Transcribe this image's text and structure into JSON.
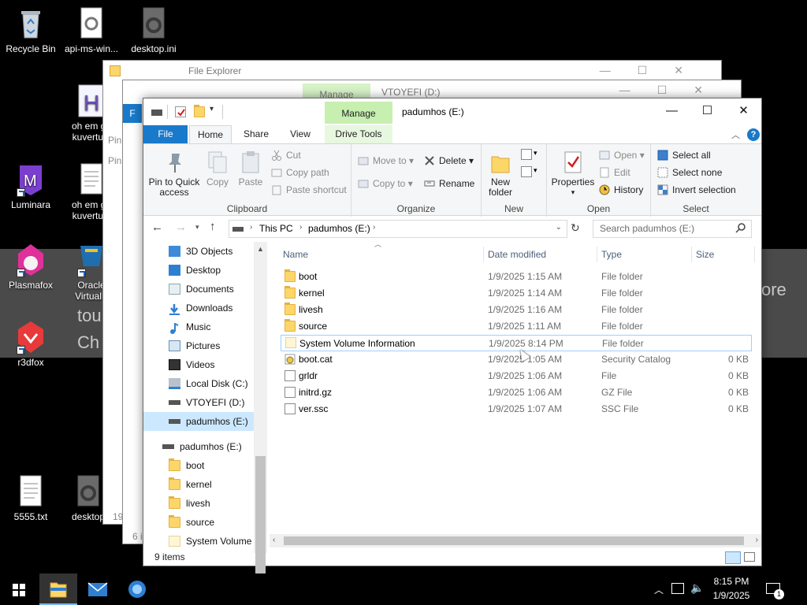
{
  "desktop": {
    "icons": [
      {
        "label": "Recycle Bin",
        "icon": "recycle-bin-icon"
      },
      {
        "label": "api-ms-win...",
        "icon": "settings-file-icon"
      },
      {
        "label": "desktop.ini",
        "icon": "settings-file-icon"
      },
      {
        "label": "oh em ge kuvertu s",
        "icon": "app-icon"
      },
      {
        "label": "Luminara",
        "icon": "luminara-icon"
      },
      {
        "label": "oh em ge kuvertu s",
        "icon": "text-file-icon"
      },
      {
        "label": "Plasmafox",
        "icon": "plasmafox-icon"
      },
      {
        "label": "Oracle VirtualB",
        "icon": "virtualbox-icon"
      },
      {
        "label": "r3dfox",
        "icon": "r3dfox-icon"
      },
      {
        "label": "5555.txt",
        "icon": "text-file-icon"
      },
      {
        "label": "desktop",
        "icon": "settings-file-icon"
      }
    ],
    "banner_lines": [
      "tou",
      "Ch",
      "ore"
    ]
  },
  "back_windows": [
    {
      "title": "File Explorer",
      "partial": [
        "Pin",
        "Pin",
        "19",
        "6 i"
      ]
    },
    {
      "title": "VTOYEFI (D:)",
      "manage": "Manage",
      "partial": [
        "F"
      ]
    }
  ],
  "window": {
    "title": "padumhos (E:)",
    "manage_tab": "Manage",
    "tabs": [
      "File",
      "Home",
      "Share",
      "View",
      "Drive Tools"
    ],
    "ribbon": {
      "clipboard": {
        "pin": "Pin to Quick access",
        "copy": "Copy",
        "paste": "Paste",
        "cut": "Cut",
        "copy_path": "Copy path",
        "paste_shortcut": "Paste shortcut",
        "label": "Clipboard"
      },
      "organize": {
        "move_to": "Move to",
        "copy_to": "Copy to",
        "delete": "Delete",
        "rename": "Rename",
        "label": "Organize"
      },
      "new": {
        "new_folder": "New folder",
        "label": "New"
      },
      "open": {
        "properties": "Properties",
        "open": "Open",
        "edit": "Edit",
        "history": "History",
        "label": "Open"
      },
      "select": {
        "select_all": "Select all",
        "select_none": "Select none",
        "invert": "Invert selection",
        "label": "Select"
      }
    },
    "address": {
      "segments": [
        "This PC",
        "padumhos (E:)"
      ]
    },
    "search": {
      "placeholder": "Search padumhos (E:)"
    },
    "nav": [
      {
        "label": "3D Objects",
        "icon": "3d-objects-icon"
      },
      {
        "label": "Desktop",
        "icon": "desktop-icon"
      },
      {
        "label": "Documents",
        "icon": "documents-icon"
      },
      {
        "label": "Downloads",
        "icon": "downloads-icon"
      },
      {
        "label": "Music",
        "icon": "music-icon"
      },
      {
        "label": "Pictures",
        "icon": "pictures-icon"
      },
      {
        "label": "Videos",
        "icon": "videos-icon"
      },
      {
        "label": "Local Disk (C:)",
        "icon": "local-disk-icon"
      },
      {
        "label": "VTOYEFI (D:)",
        "icon": "drive-icon"
      },
      {
        "label": "padumhos (E:)",
        "icon": "drive-icon"
      },
      {
        "label": "padumhos (E:)",
        "icon": "drive-icon"
      },
      {
        "label": "boot",
        "icon": "folder-icon"
      },
      {
        "label": "kernel",
        "icon": "folder-icon"
      },
      {
        "label": "livesh",
        "icon": "folder-icon"
      },
      {
        "label": "source",
        "icon": "folder-icon"
      },
      {
        "label": "System Volume I",
        "icon": "folder-icon"
      }
    ],
    "columns": {
      "name": "Name",
      "date": "Date modified",
      "type": "Type",
      "size": "Size"
    },
    "files": [
      {
        "name": "boot",
        "date": "1/9/2025 1:15 AM",
        "type": "File folder",
        "size": "",
        "icon": "folder-icon"
      },
      {
        "name": "kernel",
        "date": "1/9/2025 1:14 AM",
        "type": "File folder",
        "size": "",
        "icon": "folder-icon"
      },
      {
        "name": "livesh",
        "date": "1/9/2025 1:16 AM",
        "type": "File folder",
        "size": "",
        "icon": "folder-icon"
      },
      {
        "name": "source",
        "date": "1/9/2025 1:11 AM",
        "type": "File folder",
        "size": "",
        "icon": "folder-icon"
      },
      {
        "name": "System Volume Information",
        "date": "1/9/2025 8:14 PM",
        "type": "File folder",
        "size": "",
        "icon": "folder-icon"
      },
      {
        "name": "boot.cat",
        "date": "1/9/2025 1:05 AM",
        "type": "Security Catalog",
        "size": "0 KB",
        "icon": "security-catalog-icon"
      },
      {
        "name": "grldr",
        "date": "1/9/2025 1:06 AM",
        "type": "File",
        "size": "0 KB",
        "icon": "file-icon"
      },
      {
        "name": "initrd.gz",
        "date": "1/9/2025 1:06 AM",
        "type": "GZ File",
        "size": "0 KB",
        "icon": "file-icon"
      },
      {
        "name": "ver.ssc",
        "date": "1/9/2025 1:07 AM",
        "type": "SSC File",
        "size": "0 KB",
        "icon": "file-icon"
      }
    ],
    "status": "9 items"
  },
  "taskbar": {
    "time": "8:15 PM",
    "date": "1/9/2025",
    "notifications": "1"
  },
  "colors": {
    "accent": "#1979ca",
    "manage": "#c6efb0",
    "select_bg": "#cce8ff",
    "folder": "#fdd66a"
  }
}
